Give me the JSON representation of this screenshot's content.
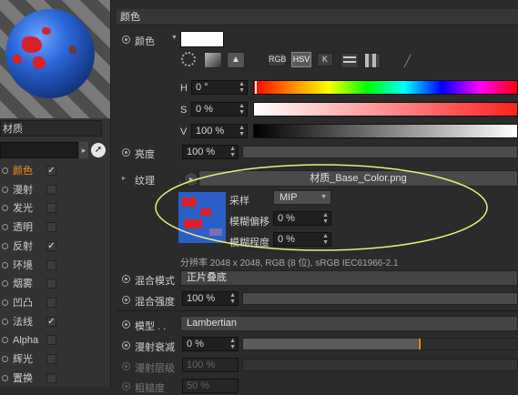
{
  "sidebar": {
    "material_label": "材质",
    "channels": [
      {
        "label": "颜色",
        "checked": true,
        "active": true
      },
      {
        "label": "漫射",
        "checked": false
      },
      {
        "label": "发光",
        "checked": false
      },
      {
        "label": "透明",
        "checked": false
      },
      {
        "label": "反射",
        "checked": true
      },
      {
        "label": "环境",
        "checked": false
      },
      {
        "label": "烟雾",
        "checked": false
      },
      {
        "label": "凹凸",
        "checked": false
      },
      {
        "label": "法线",
        "checked": true
      },
      {
        "label": "Alpha",
        "checked": false
      },
      {
        "label": "辉光",
        "checked": false
      },
      {
        "label": "置换",
        "checked": false
      }
    ],
    "check_glyph": "✓"
  },
  "color_section": {
    "title": "颜色",
    "color_label": "颜色",
    "color_swatch": "#ffffff",
    "mode_buttons": [
      "RGB",
      "HSV",
      "K"
    ],
    "h_label": "H",
    "h_value": "0 °",
    "s_label": "S",
    "s_value": "0 %",
    "v_label": "V",
    "v_value": "100 %",
    "brightness_label": "亮度",
    "brightness_value": "100 %"
  },
  "texture": {
    "label": "纹理",
    "file": "材质_Base_Color.png",
    "sampling_label": "采样",
    "sampling_value": "MIP",
    "blur_offset_label": "模糊偏移",
    "blur_offset_value": "0 %",
    "blur_scale_label": "模糊程度",
    "blur_scale_value": "0 %",
    "resolution": "分辨率 2048 x 2048, RGB (8 位), sRGB IEC61966-2.1"
  },
  "mix": {
    "mode_label": "混合模式",
    "mode_value": "正片叠底",
    "strength_label": "混合强度",
    "strength_value": "100 %"
  },
  "model": {
    "label": "模型 . .",
    "value": "Lambertian",
    "diffuse_falloff_label": "漫射衰减",
    "diffuse_falloff_value": "0 %",
    "diffuse_level_label": "漫射层级",
    "diffuse_level_value": "100 %",
    "roughness_label": "粗糙度",
    "roughness_value": "50 %"
  },
  "colors": {
    "accent_orange": "#ff8a1c",
    "annotation_ellipse": "#e8f07a"
  }
}
